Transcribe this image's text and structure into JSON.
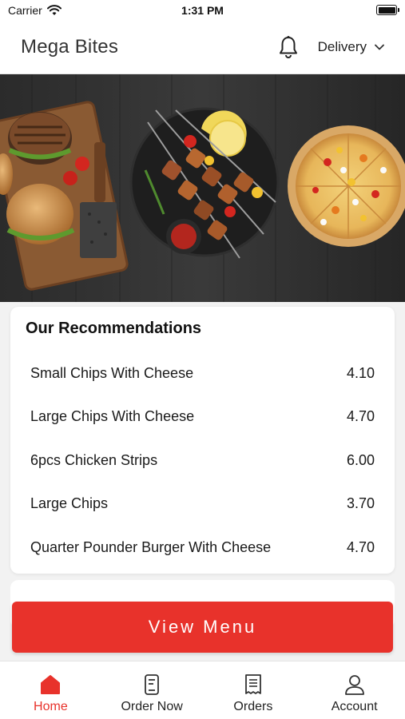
{
  "status_bar": {
    "carrier": "Carrier",
    "time": "1:31 PM"
  },
  "header": {
    "title": "Mega Bites",
    "bell_icon": "bell-icon",
    "mode": "Delivery",
    "mode_icon": "chevron-down-icon"
  },
  "hero": {
    "image": "food-banner-burgers-skewers-pizza"
  },
  "recommendations": {
    "title": "Our Recommendations",
    "items": [
      {
        "name": "Small Chips With Cheese",
        "price": "4.10"
      },
      {
        "name": "Large Chips With Cheese",
        "price": "4.70"
      },
      {
        "name": "6pcs Chicken Strips",
        "price": "6.00"
      },
      {
        "name": "Large Chips",
        "price": "3.70"
      },
      {
        "name": "Quarter Pounder Burger With Cheese",
        "price": "4.70"
      }
    ]
  },
  "view_menu": {
    "label": "View Menu"
  },
  "tabs": [
    {
      "label": "Home",
      "icon": "home-icon",
      "active": true
    },
    {
      "label": "Order Now",
      "icon": "order-icon",
      "active": false
    },
    {
      "label": "Orders",
      "icon": "receipt-icon",
      "active": false
    },
    {
      "label": "Account",
      "icon": "user-icon",
      "active": false
    }
  ],
  "colors": {
    "accent": "#e8322b",
    "background": "#f2f2f2"
  }
}
